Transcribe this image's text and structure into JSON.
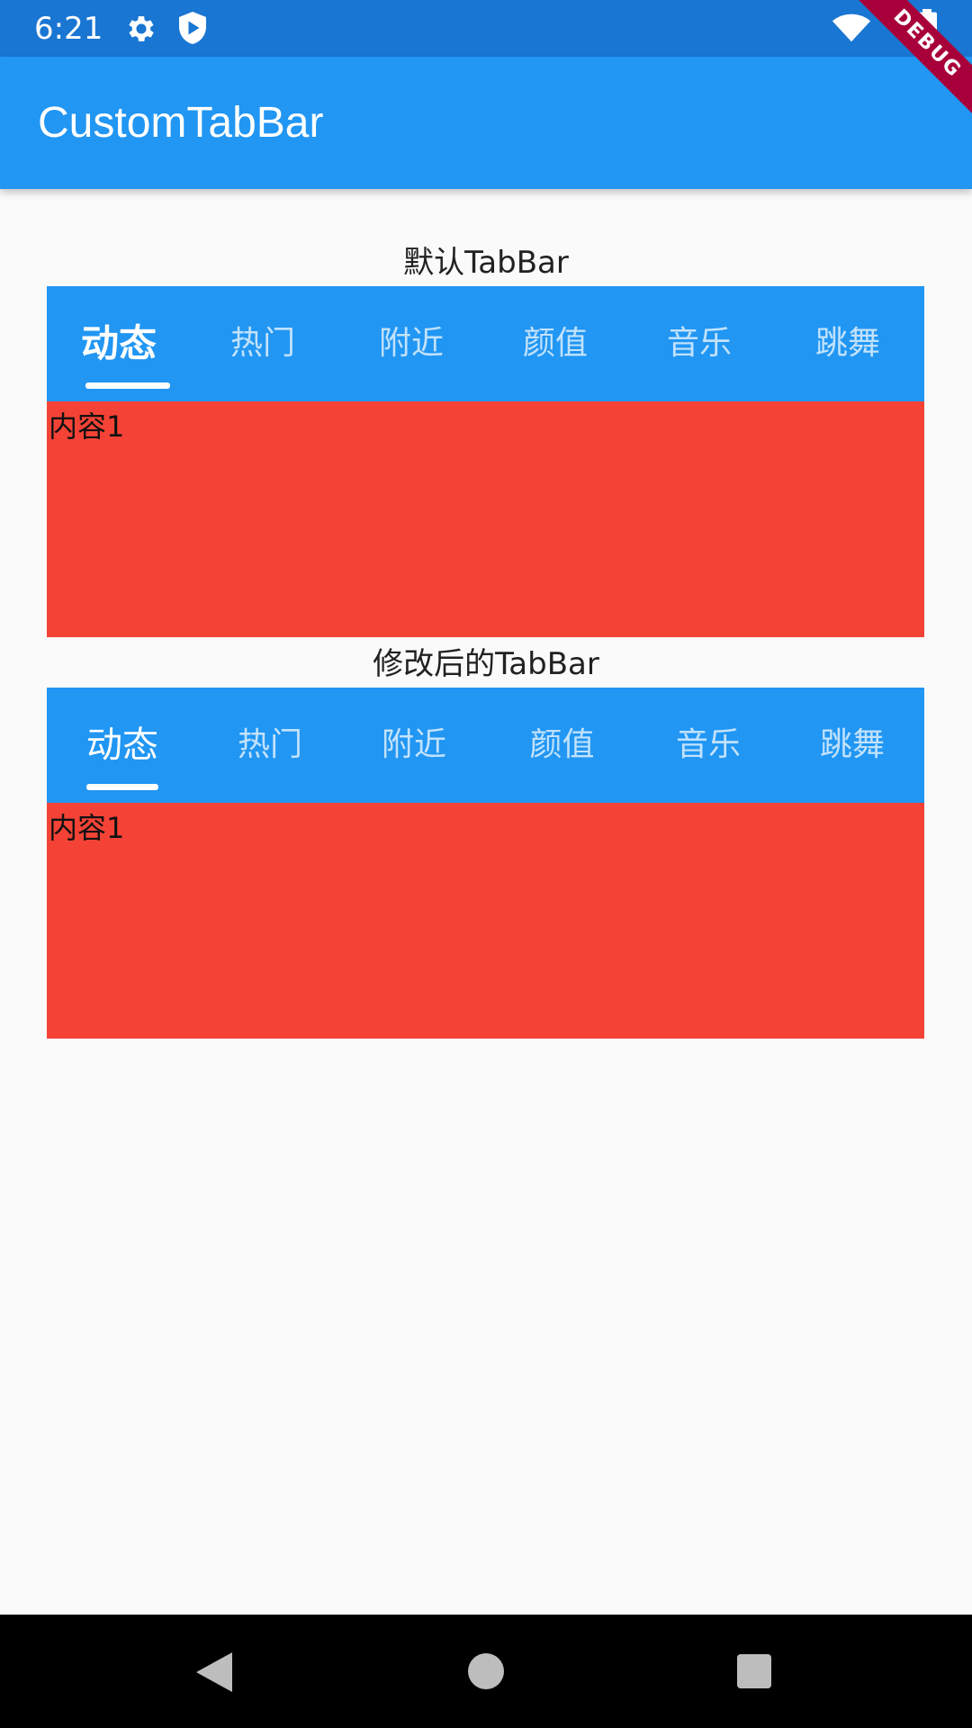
{
  "status_bar": {
    "time": "6:21",
    "icons": [
      "gear-icon",
      "shield-icon",
      "wifi-icon",
      "battery-icon"
    ]
  },
  "app_bar": {
    "title": "CustomTabBar",
    "color": "#2196f3"
  },
  "debug_banner": "DEBUG",
  "sections": [
    {
      "label": "默认TabBar",
      "tabs": [
        "动态",
        "热门",
        "附近",
        "颜值",
        "音乐",
        "跳舞"
      ],
      "selected_index": 0,
      "content": "内容1"
    },
    {
      "label": "修改后的TabBar",
      "tabs": [
        "动态",
        "热门",
        "附近",
        "颜值",
        "音乐",
        "跳舞"
      ],
      "selected_index": 0,
      "content": "内容1"
    }
  ],
  "colors": {
    "status_bar": "#1976d2",
    "tab_bar": "#2196f3",
    "content": "#f44336",
    "background": "#fafafa"
  },
  "nav_bar": {
    "icons": [
      "back-icon",
      "home-icon",
      "recents-icon"
    ]
  }
}
